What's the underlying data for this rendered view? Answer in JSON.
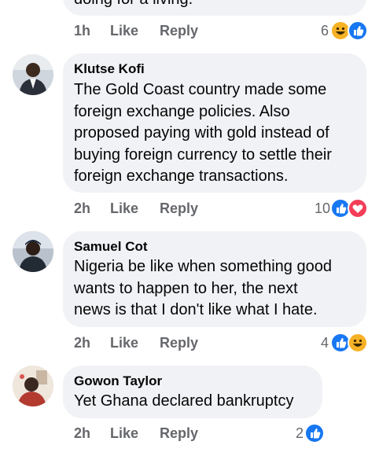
{
  "comments": [
    {
      "text": "doing for a living.",
      "time": "1h",
      "like": "Like",
      "reply": "Reply",
      "count": "6",
      "reactions": [
        "haha",
        "like"
      ]
    },
    {
      "author": "Klutse Kofi",
      "text_lines": [
        "The Gold Coast country made some",
        "foreign exchange policies. Also",
        "proposed paying with gold instead of",
        "buying foreign currency to settle their",
        "foreign exchange transactions."
      ],
      "time": "2h",
      "like": "Like",
      "reply": "Reply",
      "count": "10",
      "reactions": [
        "like",
        "love"
      ]
    },
    {
      "author": "Samuel Cot",
      "text_lines": [
        "Nigeria be like when something good",
        "wants to happen to her, the next",
        "news is that I don't like what I hate."
      ],
      "time": "2h",
      "like": "Like",
      "reply": "Reply",
      "count": "4",
      "reactions": [
        "like",
        "haha"
      ]
    },
    {
      "author": "Gowon Taylor",
      "text": "Yet Ghana declared bankruptcy",
      "time": "2h",
      "like": "Like",
      "reply": "Reply",
      "count": "2",
      "reactions": [
        "like"
      ]
    }
  ],
  "colors": {
    "like": "#1877f2",
    "love": "#f33e58",
    "haha": "#f7b125",
    "bubble": "#f0f2f5",
    "meta": "#65676b"
  }
}
